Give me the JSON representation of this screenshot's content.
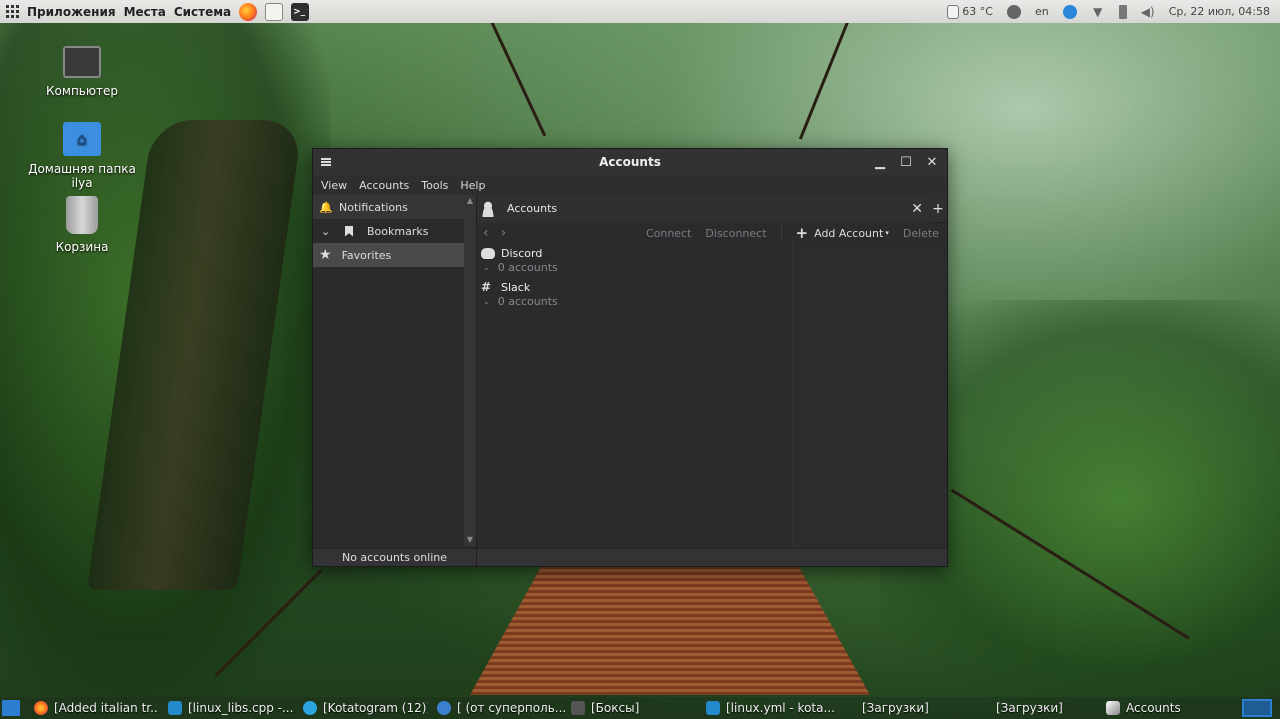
{
  "top_panel": {
    "applications": "Приложения",
    "places": "Места",
    "system": "Система",
    "temperature": "63 °C",
    "keyboard_layout": "en",
    "datetime": "Ср, 22 июл, 04:58"
  },
  "desktop": {
    "icons": [
      {
        "label": "Компьютер"
      },
      {
        "label": "Домашняя папка ilya"
      },
      {
        "label": "Корзина"
      }
    ]
  },
  "window": {
    "title": "Accounts",
    "menu": [
      "View",
      "Accounts",
      "Tools",
      "Help"
    ],
    "sidebar": {
      "items": [
        {
          "label": "Notifications"
        },
        {
          "label": "Bookmarks"
        },
        {
          "label": "Favorites"
        }
      ],
      "status": "No accounts online"
    },
    "tab": {
      "label": "Accounts"
    },
    "toolbar": {
      "connect": "Connect",
      "disconnect": "Disconnect",
      "add_account": "Add Account",
      "delete": "Delete"
    },
    "protocols": [
      {
        "name": "Discord",
        "count": "0 accounts"
      },
      {
        "name": "Slack",
        "count": "0 accounts"
      }
    ]
  },
  "taskbar": {
    "tasks": [
      {
        "label": "[Added italian tr..."
      },
      {
        "label": "[linux_libs.cpp -..."
      },
      {
        "label": "[Kotatogram (12)]"
      },
      {
        "label": "[ (от суперполь..."
      },
      {
        "label": "[Боксы]"
      },
      {
        "label": "[linux.yml - kota..."
      },
      {
        "label": "[Загрузки]"
      },
      {
        "label": "[Загрузки]"
      },
      {
        "label": "Accounts"
      }
    ]
  },
  "colors": {
    "panel_bg": "#e0e0de",
    "window_bg": "#2b2b2d",
    "selected_item": "#4a4a4d",
    "folder_blue": "#3c8fe0",
    "accent_blue": "#2c7fd0"
  }
}
